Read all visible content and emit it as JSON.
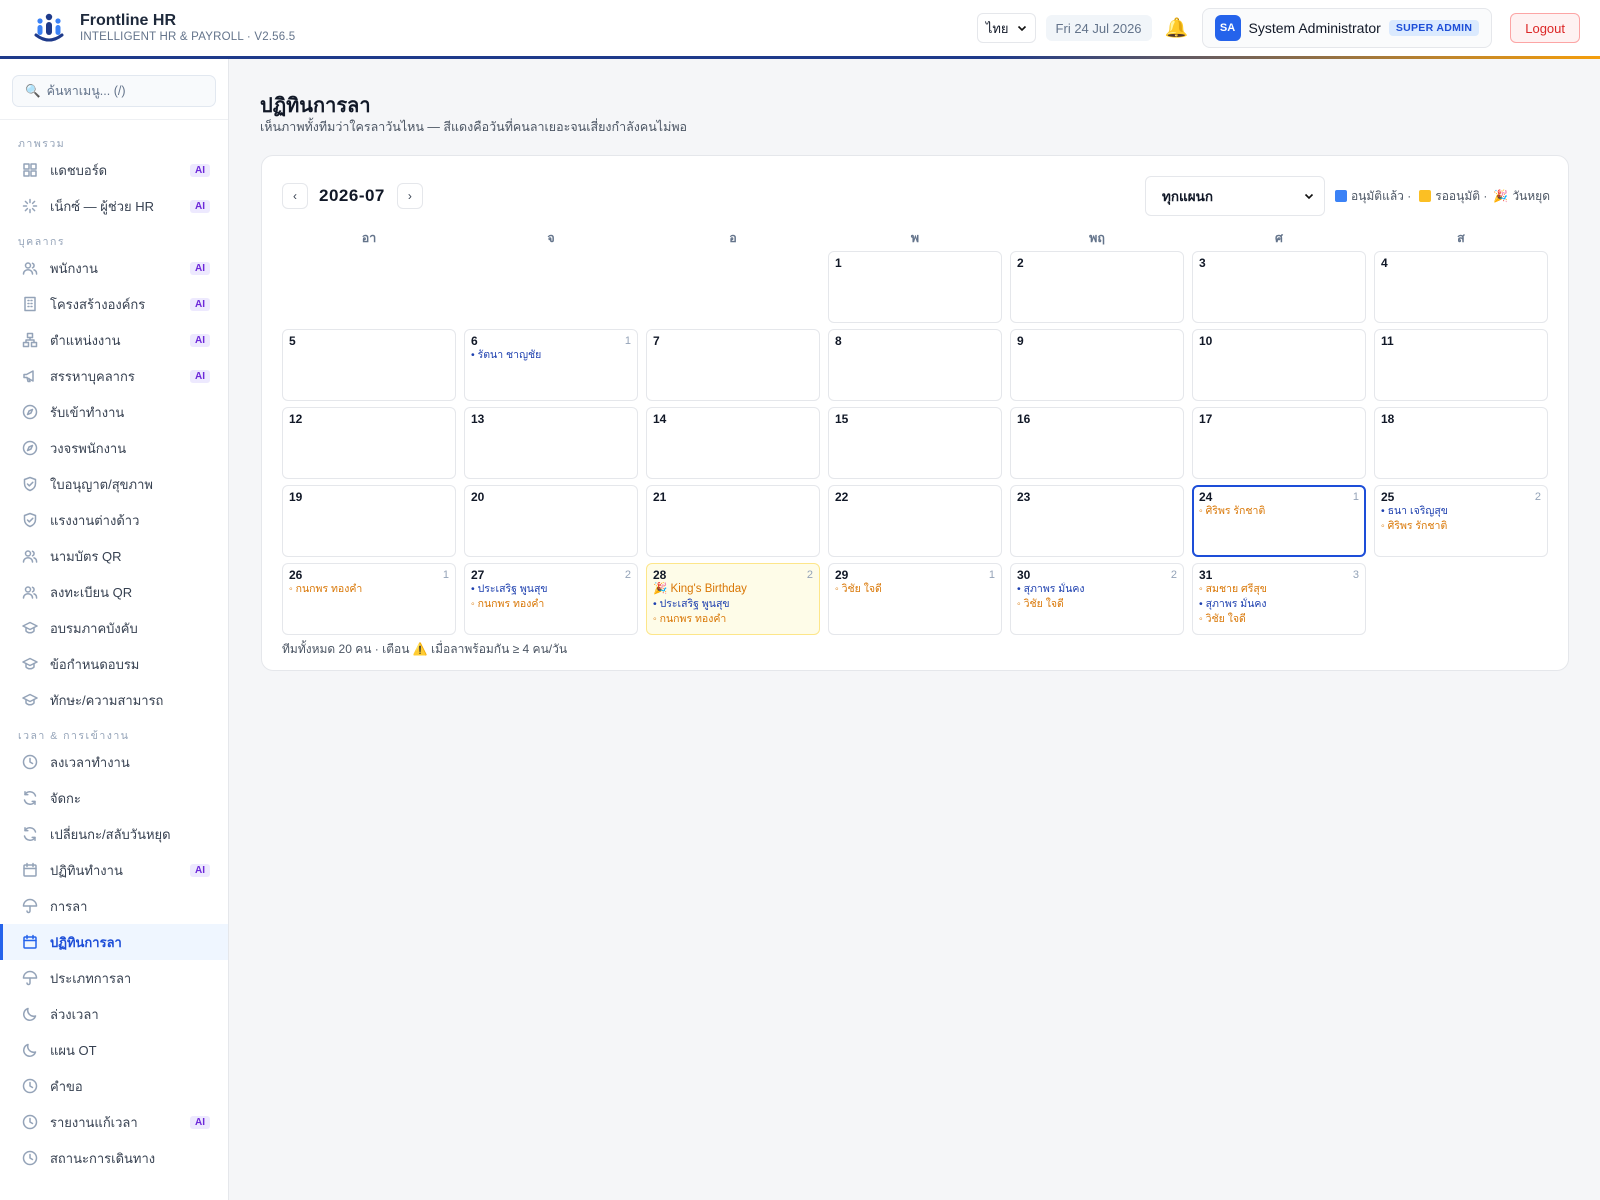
{
  "header": {
    "app_name": "Frontline HR",
    "app_sub": "INTELLIGENT HR & PAYROLL · V2.56.5",
    "lang": "ไทย",
    "date": "Fri 24 Jul 2026",
    "avatar_initials": "SA",
    "user_name": "System Administrator",
    "role": "SUPER ADMIN",
    "logout": "Logout"
  },
  "sidebar": {
    "search_placeholder": "ค้นหาเมนู... (/)",
    "sections": [
      {
        "title": "ภาพรวม",
        "items": [
          {
            "label": "แดชบอร์ด",
            "icon": "grid-icon",
            "ai": true
          },
          {
            "label": "เน็กซ์ — ผู้ช่วย HR",
            "icon": "sparkle-icon",
            "ai": true
          }
        ]
      },
      {
        "title": "บุคลากร",
        "items": [
          {
            "label": "พนักงาน",
            "icon": "users-icon",
            "ai": true
          },
          {
            "label": "โครงสร้างองค์กร",
            "icon": "building-icon",
            "ai": true
          },
          {
            "label": "ตำแหน่งงาน",
            "icon": "hierarchy-icon",
            "ai": true
          },
          {
            "label": "สรรหาบุคลากร",
            "icon": "megaphone-icon",
            "ai": true
          },
          {
            "label": "รับเข้าทำงาน",
            "icon": "compass-icon",
            "ai": false
          },
          {
            "label": "วงจรพนักงาน",
            "icon": "compass-icon",
            "ai": false
          },
          {
            "label": "ใบอนุญาต/สุขภาพ",
            "icon": "shield-icon",
            "ai": false
          },
          {
            "label": "แรงงานต่างด้าว",
            "icon": "shield-icon",
            "ai": false
          },
          {
            "label": "นามบัตร QR",
            "icon": "users-icon",
            "ai": false
          },
          {
            "label": "ลงทะเบียน QR",
            "icon": "users-icon",
            "ai": false
          },
          {
            "label": "อบรมภาคบังคับ",
            "icon": "graduation-icon",
            "ai": false
          },
          {
            "label": "ข้อกำหนดอบรม",
            "icon": "graduation-icon",
            "ai": false
          },
          {
            "label": "ทักษะ/ความสามารถ",
            "icon": "graduation-icon",
            "ai": false
          }
        ]
      },
      {
        "title": "เวลา & การเข้างาน",
        "items": [
          {
            "label": "ลงเวลาทำงาน",
            "icon": "clock-icon",
            "ai": false
          },
          {
            "label": "จัดกะ",
            "icon": "refresh-icon",
            "ai": false
          },
          {
            "label": "เปลี่ยนกะ/สลับวันหยุด",
            "icon": "refresh-icon",
            "ai": false
          },
          {
            "label": "ปฏิทินทำงาน",
            "icon": "calendar-icon",
            "ai": true
          },
          {
            "label": "การลา",
            "icon": "umbrella-icon",
            "ai": false
          },
          {
            "label": "ปฏิทินการลา",
            "icon": "calendar-icon",
            "ai": false,
            "active": true
          },
          {
            "label": "ประเภทการลา",
            "icon": "umbrella-icon",
            "ai": false
          },
          {
            "label": "ล่วงเวลา",
            "icon": "moon-icon",
            "ai": false
          },
          {
            "label": "แผน OT",
            "icon": "moon-icon",
            "ai": false
          },
          {
            "label": "คำขอ",
            "icon": "clock-icon",
            "ai": false
          },
          {
            "label": "รายงานแก้เวลา",
            "icon": "clock-icon",
            "ai": true
          },
          {
            "label": "สถานะการเดินทาง",
            "icon": "clock-icon",
            "ai": false
          }
        ]
      }
    ],
    "ai_label": "AI"
  },
  "page": {
    "title": "ปฏิทินการลา",
    "subtitle": "เห็นภาพทั้งทีมว่าใครลาวันไหน — สีแดงคือวันที่คนลาเยอะจนเสี่ยงกำลังคนไม่พอ"
  },
  "calendar": {
    "month": "2026-07",
    "prev": "‹",
    "next": "›",
    "dept_filter": "ทุกแผนก",
    "legend_approved": "อนุมัติแล้ว ·",
    "legend_pending": "รออนุมัติ ·",
    "legend_holiday": "วันหยุด",
    "holiday_icon": "🎉",
    "colors": {
      "approved": "#1e40af",
      "pending": "#d97706",
      "today": "#1d4ed8",
      "approved_sq": "#3b82f6",
      "pending_sq": "#fbbf24"
    },
    "weekdays": [
      "อา",
      "จ",
      "อ",
      "พ",
      "พฤ",
      "ศ",
      "ส"
    ],
    "first_weekday": 3,
    "days_in_month": 31,
    "today": 24,
    "days": {
      "6": {
        "count": "1",
        "events": [
          {
            "name": "• รัตนา ชาญชัย",
            "status": "approved"
          }
        ]
      },
      "24": {
        "count": "1",
        "events": [
          {
            "name": "◦ ศิริพร รักชาติ",
            "status": "pending"
          }
        ]
      },
      "25": {
        "count": "2",
        "events": [
          {
            "name": "• ธนา เจริญสุข",
            "status": "approved"
          },
          {
            "name": "◦ ศิริพร รักชาติ",
            "status": "pending"
          }
        ]
      },
      "26": {
        "count": "1",
        "events": [
          {
            "name": "◦ กนกพร ทองคำ",
            "status": "pending"
          }
        ]
      },
      "27": {
        "count": "2",
        "events": [
          {
            "name": "• ประเสริฐ พูนสุข",
            "status": "approved"
          },
          {
            "name": "◦ กนกพร ทองคำ",
            "status": "pending"
          }
        ]
      },
      "28": {
        "count": "2",
        "holiday": "King's Birthday",
        "events": [
          {
            "name": "• ประเสริฐ พูนสุข",
            "status": "approved"
          },
          {
            "name": "◦ กนกพร ทองคำ",
            "status": "pending"
          }
        ]
      },
      "29": {
        "count": "1",
        "events": [
          {
            "name": "◦ วิชัย ใจดี",
            "status": "pending"
          }
        ]
      },
      "30": {
        "count": "2",
        "events": [
          {
            "name": "• สุภาพร มั่นคง",
            "status": "approved"
          },
          {
            "name": "◦ วิชัย ใจดี",
            "status": "pending"
          }
        ]
      },
      "31": {
        "count": "3",
        "events": [
          {
            "name": "◦ สมชาย ศรีสุข",
            "status": "pending"
          },
          {
            "name": "• สุภาพร มั่นคง",
            "status": "approved"
          },
          {
            "name": "◦ วิชัย ใจดี",
            "status": "pending"
          }
        ]
      }
    },
    "footer": "ทีมทั้งหมด 20 คน · เตือน ⚠️ เมื่อลาพร้อมกัน ≥ 4 คน/วัน"
  }
}
